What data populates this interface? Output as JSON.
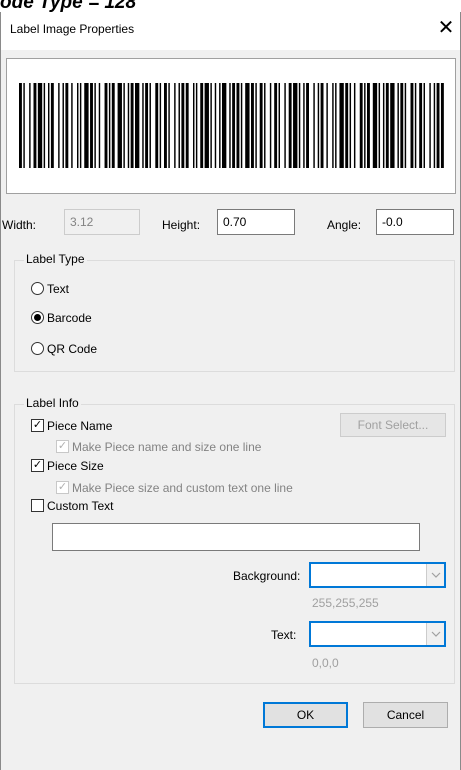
{
  "caption": "ode Type = 128",
  "window": {
    "title": "Label Image Properties",
    "close_glyph": "✕"
  },
  "dims": {
    "width_label": "Width:",
    "width_value": "3.12",
    "height_label": "Height:",
    "height_value": "0.70",
    "angle_label": "Angle:",
    "angle_value": "-0.0"
  },
  "label_type": {
    "title": "Label Type",
    "options": [
      {
        "label": "Text",
        "checked": false
      },
      {
        "label": "Barcode",
        "checked": true
      },
      {
        "label": "QR Code",
        "checked": false
      }
    ]
  },
  "label_info": {
    "title": "Label Info",
    "piece_name": "Piece Name",
    "font_select": "Font Select...",
    "piece_name_one_line": "Make Piece name and size one line",
    "piece_size": "Piece Size",
    "piece_size_one_line": "Make Piece size and custom text one line",
    "custom_text": "Custom Text",
    "custom_text_value": "",
    "background_label": "Background:",
    "background_rgb": "255,255,255",
    "text_label": "Text:",
    "text_rgb": "0,0,0",
    "check_glyph": "✓"
  },
  "buttons": {
    "ok": "OK",
    "cancel": "Cancel"
  },
  "colors": {
    "accent": "#0078d7",
    "background_swatch": "#ffffff",
    "text_swatch": "#000000"
  },
  "icons": {
    "close": "close-icon",
    "dropdown": "chevron-down-icon",
    "check": "check-icon"
  }
}
